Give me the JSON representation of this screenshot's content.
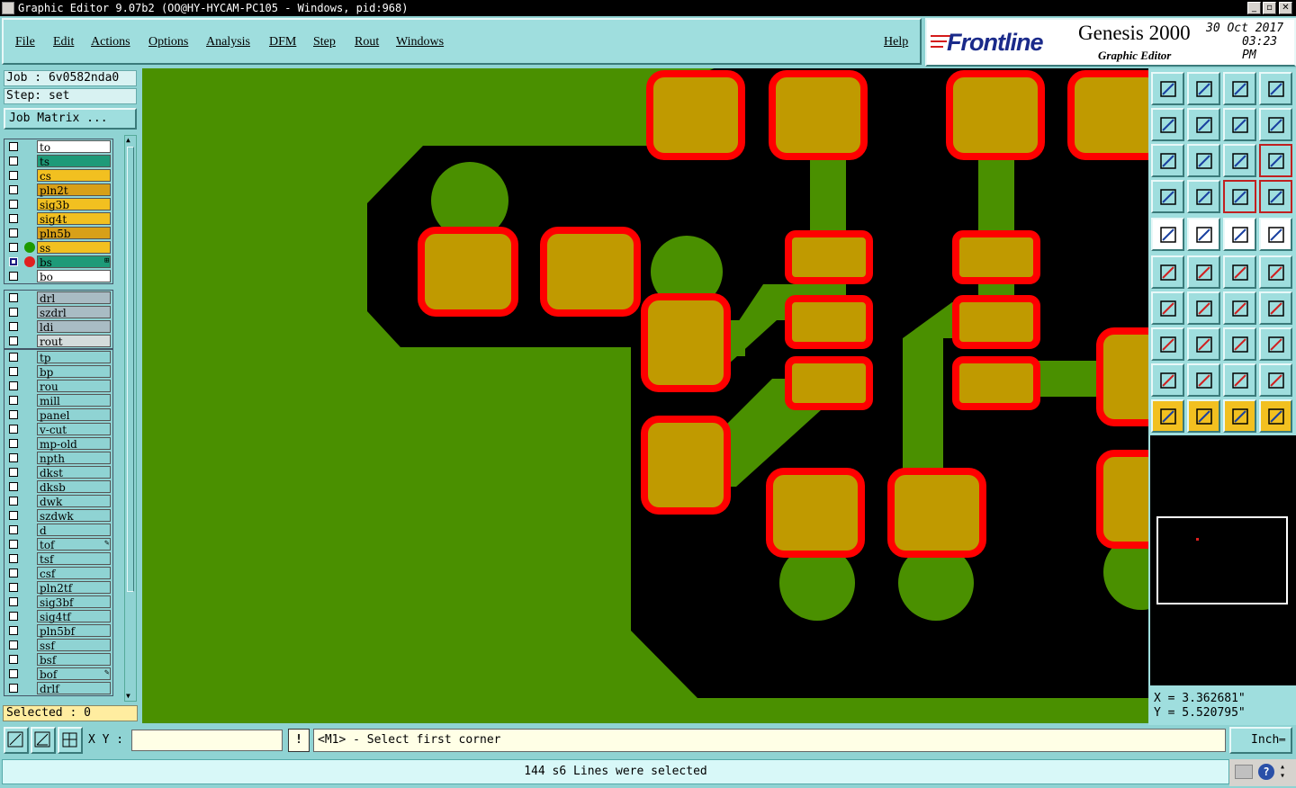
{
  "window": {
    "title": "Graphic Editor 9.07b2 (OO@HY-HYCAM-PC105 - Windows, pid:968)"
  },
  "menu": [
    {
      "label": "File"
    },
    {
      "label": "Edit"
    },
    {
      "label": "Actions"
    },
    {
      "label": "Options"
    },
    {
      "label": "Analysis"
    },
    {
      "label": "DFM"
    },
    {
      "label": "Step"
    },
    {
      "label": "Rout"
    },
    {
      "label": "Windows"
    },
    {
      "label": "Help"
    }
  ],
  "brand": {
    "logo": "Frontline",
    "product": "Genesis 2000",
    "module": "Graphic Editor",
    "date": "30 Oct 2017",
    "time": "03:23 PM"
  },
  "job": {
    "job_label": "Job : 6v0582nda0",
    "step_label": "Step: set",
    "matrix_button": "Job Matrix ..."
  },
  "layer_groups": [
    [
      {
        "name": "to",
        "color": "#ffffff"
      },
      {
        "name": "ts",
        "color": "#1e9a78"
      },
      {
        "name": "cs",
        "color": "#f2c020"
      },
      {
        "name": "pln2t",
        "color": "#d8a018"
      },
      {
        "name": "sig3b",
        "color": "#f2c020"
      },
      {
        "name": "sig4t",
        "color": "#f2c020"
      },
      {
        "name": "pln5b",
        "color": "#d8a018"
      },
      {
        "name": "ss",
        "color": "#f2c020",
        "dot": "#1e9a00"
      },
      {
        "name": "bs",
        "color": "#1e9a78",
        "dot": "#e02020",
        "work": true
      },
      {
        "name": "bo",
        "color": "#ffffff"
      }
    ],
    [
      {
        "name": "drl",
        "color": "#a9bcc4"
      },
      {
        "name": "szdrl",
        "color": "#a9bcc4"
      },
      {
        "name": "ldi",
        "color": "#a9bcc4"
      },
      {
        "name": "rout",
        "color": "#d4dcdc"
      }
    ],
    [
      {
        "name": "tp",
        "color": "#8fd3d3"
      },
      {
        "name": "bp",
        "color": "#8fd3d3"
      },
      {
        "name": "rou",
        "color": "#8fd3d3"
      },
      {
        "name": "mill",
        "color": "#8fd3d3"
      },
      {
        "name": "panel",
        "color": "#8fd3d3"
      },
      {
        "name": "v-cut",
        "color": "#8fd3d3"
      },
      {
        "name": "mp-old",
        "color": "#8fd3d3"
      },
      {
        "name": "npth",
        "color": "#8fd3d3"
      },
      {
        "name": "dkst",
        "color": "#8fd3d3"
      },
      {
        "name": "dksb",
        "color": "#8fd3d3"
      },
      {
        "name": "dwk",
        "color": "#8fd3d3"
      },
      {
        "name": "szdwk",
        "color": "#8fd3d3"
      },
      {
        "name": "d",
        "color": "#8fd3d3"
      },
      {
        "name": "tof",
        "color": "#8fd3d3",
        "mark": "✎"
      },
      {
        "name": "tsf",
        "color": "#8fd3d3"
      },
      {
        "name": "csf",
        "color": "#8fd3d3"
      },
      {
        "name": "pln2tf",
        "color": "#8fd3d3"
      },
      {
        "name": "sig3bf",
        "color": "#8fd3d3"
      },
      {
        "name": "sig4tf",
        "color": "#8fd3d3"
      },
      {
        "name": "pln5bf",
        "color": "#8fd3d3"
      },
      {
        "name": "ssf",
        "color": "#8fd3d3"
      },
      {
        "name": "bsf",
        "color": "#8fd3d3"
      },
      {
        "name": "bof",
        "color": "#8fd3d3",
        "mark": "✎"
      },
      {
        "name": "drlf",
        "color": "#8fd3d3"
      }
    ]
  ],
  "selected_label": "Selected : 0",
  "coords": {
    "x": "X = 3.362681\"",
    "y": "Y = 5.520795\""
  },
  "bottom": {
    "xy_label": "X Y :",
    "xy_value": "",
    "prompt": "<M1> - Select first corner",
    "unit": "Inch",
    "status": "144 s6 Lines were selected",
    "excl": "!"
  },
  "colors": {
    "board": "#4a9000",
    "copper": "#000000",
    "pad": "#c09a00",
    "pad_outline": "#ff0000",
    "panel": "#8fd3d3"
  },
  "toolbar": [
    {
      "name": "zoom-home-icon"
    },
    {
      "name": "zoom-page-icon"
    },
    {
      "name": "home-icon"
    },
    {
      "name": "split-view-icon"
    },
    {
      "name": "pan-left-icon"
    },
    {
      "name": "pan-right-icon"
    },
    {
      "name": "undo-zoom-icon"
    },
    {
      "name": "redraw-icon"
    },
    {
      "name": "fit-all-icon"
    },
    {
      "name": "fit-selection-icon"
    },
    {
      "name": "one-to-one-icon"
    },
    {
      "name": "help-query-icon"
    },
    {
      "name": "measure-icon"
    },
    {
      "name": "grid-icon"
    },
    {
      "name": "layer-control-icon"
    },
    {
      "name": "layer-control-2-icon"
    },
    {
      "name": "snap-icon"
    },
    {
      "name": "edit-shape-icon"
    },
    {
      "name": "ruler-icon"
    },
    {
      "name": "pad-icon"
    },
    {
      "name": "connect-icon"
    },
    {
      "name": "delete-node-icon"
    },
    {
      "name": "move-node-icon"
    },
    {
      "name": "add-node-icon"
    },
    {
      "name": "angle-icon"
    },
    {
      "name": "line-icon"
    },
    {
      "name": "arc-icon"
    },
    {
      "name": "mirror-icon"
    },
    {
      "name": "pad-add-icon"
    },
    {
      "name": "split-line-icon"
    },
    {
      "name": "resize-icon"
    },
    {
      "name": "shape-icon"
    },
    {
      "name": "triangle-1-icon"
    },
    {
      "name": "triangle-2-icon"
    },
    {
      "name": "triangle-3-icon"
    },
    {
      "name": "triangle-4-icon"
    },
    {
      "name": "pointer-icon"
    },
    {
      "name": "pointer-select-icon"
    },
    {
      "name": "pointer-move-icon"
    },
    {
      "name": "route-icon"
    }
  ]
}
